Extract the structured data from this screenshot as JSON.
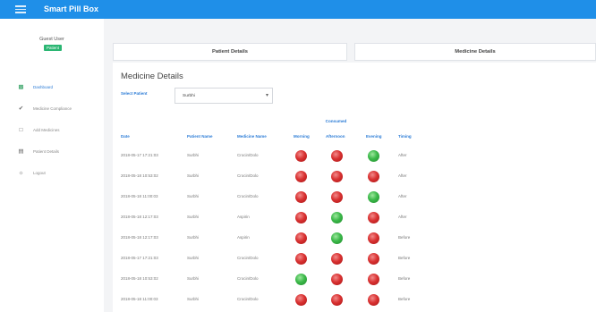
{
  "header": {
    "title": "Smart Pill Box"
  },
  "sidebar": {
    "user_name": "Guest User",
    "user_badge": "Patient",
    "items": [
      {
        "icon": "dashboard-icon",
        "label": "Dashboard",
        "active": true
      },
      {
        "icon": "pill-icon",
        "label": "Medicine Compliance",
        "active": false
      },
      {
        "icon": "calendar-icon",
        "label": "Add Medicines",
        "active": false
      },
      {
        "icon": "document-icon",
        "label": "Patient Details",
        "active": false
      },
      {
        "icon": "logout-icon",
        "label": "Logout",
        "active": false
      }
    ]
  },
  "tabs": [
    {
      "label": "Patient Details"
    },
    {
      "label": "Medicine Details"
    }
  ],
  "card": {
    "title": "Medicine Details",
    "select_label": "Select Patient",
    "select_value": "Surbhi"
  },
  "table": {
    "group_header": "Consumed",
    "headers": [
      "Date",
      "Patient Name",
      "Medicine Name",
      "Morning",
      "Afternoon",
      "Evening",
      "Timing"
    ],
    "rows": [
      {
        "date": "2018-05-17 17:21:03",
        "patient": "Surbhi",
        "medicine": "Crocin/Dolo",
        "morning": "red",
        "afternoon": "red",
        "evening": "green",
        "timing": "After"
      },
      {
        "date": "2018-05-18 10:53:02",
        "patient": "Surbhi",
        "medicine": "Crocin/Dolo",
        "morning": "red",
        "afternoon": "red",
        "evening": "red",
        "timing": "After"
      },
      {
        "date": "2018-05-18 11:00:03",
        "patient": "Surbhi",
        "medicine": "Crocin/Dolo",
        "morning": "red",
        "afternoon": "red",
        "evening": "green",
        "timing": "After"
      },
      {
        "date": "2018-05-18 12:17:03",
        "patient": "Surbhi",
        "medicine": "Aspirin",
        "morning": "red",
        "afternoon": "green",
        "evening": "red",
        "timing": "After"
      },
      {
        "date": "2018-05-18 12:17:03",
        "patient": "Surbhi",
        "medicine": "Aspirin",
        "morning": "red",
        "afternoon": "green",
        "evening": "red",
        "timing": "Before"
      },
      {
        "date": "2018-05-17 17:21:03",
        "patient": "Surbhi",
        "medicine": "Crocin/Dolo",
        "morning": "red",
        "afternoon": "red",
        "evening": "red",
        "timing": "Before"
      },
      {
        "date": "2018-05-18 10:53:02",
        "patient": "Surbhi",
        "medicine": "Crocin/Dolo",
        "morning": "green",
        "afternoon": "red",
        "evening": "red",
        "timing": "Before"
      },
      {
        "date": "2018-05-18 11:00:03",
        "patient": "Surbhi",
        "medicine": "Crocin/Dolo",
        "morning": "red",
        "afternoon": "red",
        "evening": "red",
        "timing": "Before"
      }
    ]
  },
  "colors": {
    "topbar": "#1f8fe8",
    "accent": "#2a7bd6",
    "consumed": "#3cb94a",
    "missed": "#d93232"
  }
}
